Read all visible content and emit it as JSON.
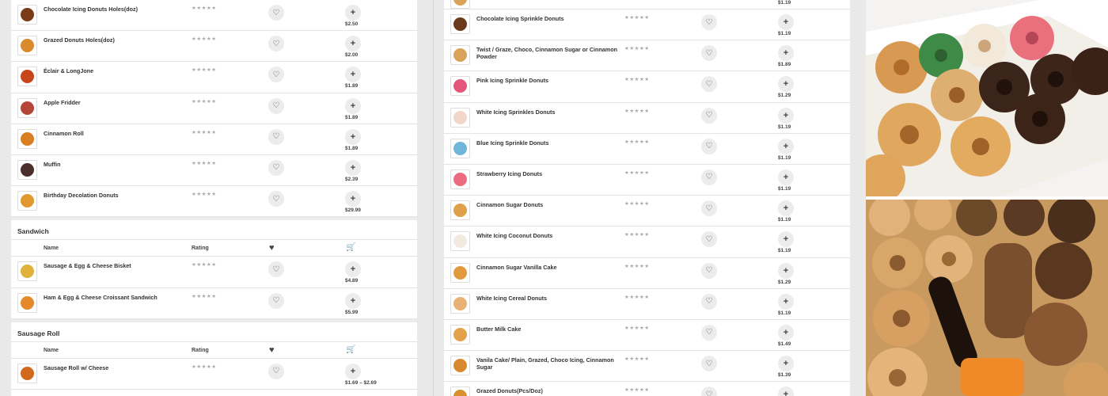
{
  "left": {
    "rows_top": [
      {
        "name": "Chocolate Icing Donuts Holes(doz)",
        "rating": "★★★★★",
        "price": "$2.50",
        "color": "#7a3b17"
      },
      {
        "name": "Grazed Donuts Holes(doz)",
        "rating": "★★★★★",
        "price": "$2.00",
        "color": "#d98a2c"
      },
      {
        "name": "Éclair & LongJone",
        "rating": "★★★★★",
        "price": "$1.89",
        "color": "#c8451c"
      },
      {
        "name": "Apple Fridder",
        "rating": "★★★★★",
        "price": "$1.89",
        "color": "#b5463a"
      },
      {
        "name": "Cinnamon Roll",
        "rating": "★★★★★",
        "price": "$1.89",
        "color": "#d97e22"
      },
      {
        "name": "Muffin",
        "rating": "★★★★★",
        "price": "$2.39",
        "color": "#4a2f2a"
      },
      {
        "name": "Birthday Decolation Donuts",
        "rating": "★★★★★",
        "price": "$29.99",
        "color": "#e1982f"
      }
    ],
    "sandwich": {
      "title": "Sandwich",
      "headers": {
        "name": "Name",
        "rating": "Rating"
      },
      "rows": [
        {
          "name": "Sausage & Egg & Cheese Bisket",
          "rating": "★★★★★",
          "price": "$4.89",
          "color": "#e0b23c"
        },
        {
          "name": "Ham & Egg & Cheese Croissant Sandwich",
          "rating": "★★★★★",
          "price": "$5.99",
          "color": "#e48a2a"
        }
      ]
    },
    "sausage_roll": {
      "title": "Sausage Roll",
      "headers": {
        "name": "Name",
        "rating": "Rating"
      },
      "rows": [
        {
          "name": "Sausage Roll w/ Cheese",
          "rating": "★★★★★",
          "price": "$1.69 – $2.69",
          "color": "#d26a1e"
        }
      ]
    }
  },
  "right": {
    "top_price": "$1.19",
    "rows": [
      {
        "name": "Chocolate Icing Sprinkle Donuts",
        "rating": "★★★★★",
        "price": "$1.19",
        "color": "#6b3a1c"
      },
      {
        "name": "Twist / Graze, Choco, Cinnamon Sugar or Cinnamon Powder",
        "rating": "★★★★★",
        "price": "$1.89",
        "color": "#d9a35a"
      },
      {
        "name": "Pink Icing Sprinkle Donuts",
        "rating": "★★★★★",
        "price": "$1.29",
        "color": "#e5577a"
      },
      {
        "name": "White Icing Sprinkles Donuts",
        "rating": "★★★★★",
        "price": "$1.19",
        "color": "#f1d7c9"
      },
      {
        "name": "Blue Icing Sprinkle Donuts",
        "rating": "★★★★★",
        "price": "$1.19",
        "color": "#6fb6d9"
      },
      {
        "name": "Strawberry Icing Donuts",
        "rating": "★★★★★",
        "price": "$1.19",
        "color": "#ec6b7e"
      },
      {
        "name": "Cinnamon Sugar Donuts",
        "rating": "★★★★★",
        "price": "$1.19",
        "color": "#e0a04a"
      },
      {
        "name": "White Icing Coconut Donuts",
        "rating": "★★★★★",
        "price": "$1.19",
        "color": "#f3eadf"
      },
      {
        "name": "Cinnamon Sugar Vanilla Cake",
        "rating": "★★★★★",
        "price": "$1.29",
        "color": "#e39a3c"
      },
      {
        "name": "White Icing Cereal Donuts",
        "rating": "★★★★★",
        "price": "$1.19",
        "color": "#e7b274"
      },
      {
        "name": "Butter Milk Cake",
        "rating": "★★★★★",
        "price": "$1.49",
        "color": "#e3a24a"
      },
      {
        "name": "Vanila Cake/ Plain, Grazed, Choco Icing, Cinnamon Sugar",
        "rating": "★★★★★",
        "price": "$1.39",
        "color": "#d8892f"
      },
      {
        "name": "Grazed Donuts(Pcs/Doz)",
        "rating": "★★★★★",
        "price": "",
        "color": "#d9902e"
      }
    ]
  }
}
